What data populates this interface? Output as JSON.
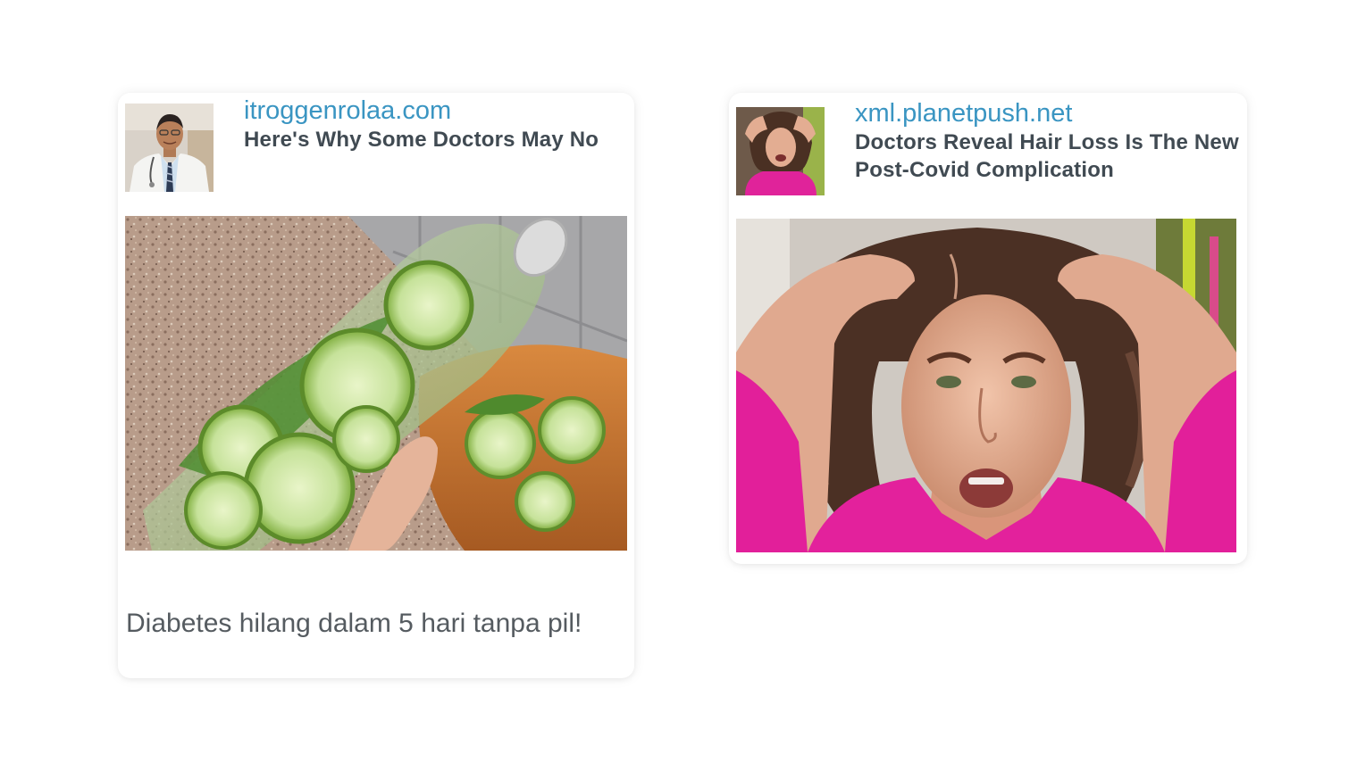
{
  "ads": [
    {
      "source": "itroggenrolaa.com",
      "headline": "Here's Why Some Doctors May No",
      "thumbnail_icon": "doctor-portrait-image",
      "image_icon": "cucumber-infused-water-bottle-image",
      "caption": "Diabetes hilang dalam 5 hari tanpa pil!"
    },
    {
      "source": "xml.planetpush.net",
      "headline": "Doctors Reveal Hair Loss Is The New Post-Covid Complication",
      "thumbnail_icon": "woman-holding-hair-image",
      "image_icon": "woman-holding-hair-image"
    }
  ],
  "colors": {
    "source_link": "#3a95c2",
    "headline_text": "#404a52",
    "caption_text": "#555b60",
    "card_background": "#ffffff"
  }
}
